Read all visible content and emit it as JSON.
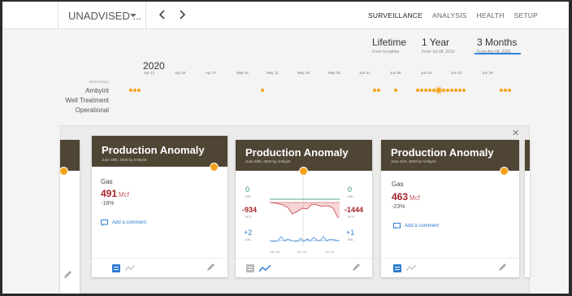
{
  "header": {
    "well_name": "UNADVISED ...",
    "tabs": [
      "SURVEILLANCE",
      "ANALYSIS",
      "HEALTH",
      "SETUP"
    ]
  },
  "ranges": [
    {
      "label": "Lifetime",
      "sub": "From Inception"
    },
    {
      "label": "1 Year",
      "sub": "From Jul 08, 2019"
    },
    {
      "label": "3 Months",
      "sub": "From Apr 08, 2020"
    }
  ],
  "timeline": {
    "year": "2020",
    "ticks": [
      "Apr 13",
      "Apr 20",
      "Apr 27",
      "May 04",
      "May 11",
      "May 18",
      "May 25",
      "Jun 01",
      "Jun 08",
      "Jun 15",
      "Jun 22",
      "Jun 29"
    ],
    "rows": [
      "Well History",
      "Ambyint",
      "Well Treatment",
      "Operational"
    ]
  },
  "cards": [
    {
      "title": "Production Anomaly",
      "sub": "June 19th, 2020 by Ambyint",
      "metric": "Gas",
      "value": "491",
      "unit": "Mcf",
      "pct": "-18%",
      "comment": "Add a comment"
    },
    {
      "title": "Production Anomaly",
      "sub": "June 20th, 2020 by Ambyint",
      "chart": {
        "top_left": "0",
        "top_left_unit": "BBL",
        "top_right": "0",
        "top_right_unit": "BBL",
        "mid_left": "-934",
        "mid_left_unit": "MCF",
        "mid_right": "-1444",
        "mid_right_unit": "MCF",
        "bot_left": "+2",
        "bot_left_unit": "BBL",
        "bot_right": "+1",
        "bot_right_unit": "BBL",
        "x_ticks": [
          "Jun 06",
          "Jun 20",
          "Jul 04"
        ]
      }
    },
    {
      "title": "Production Anomaly",
      "sub": "June 21st, 2020 by Ambyint",
      "metric": "Gas",
      "value": "463",
      "unit": "Mcf",
      "pct": "-23%",
      "comment": "Add a comment"
    }
  ],
  "colors": {
    "accent": "#2e86d4",
    "event": "#f5a21b",
    "card_header": "#4f4535",
    "negative": "#a6232a"
  }
}
